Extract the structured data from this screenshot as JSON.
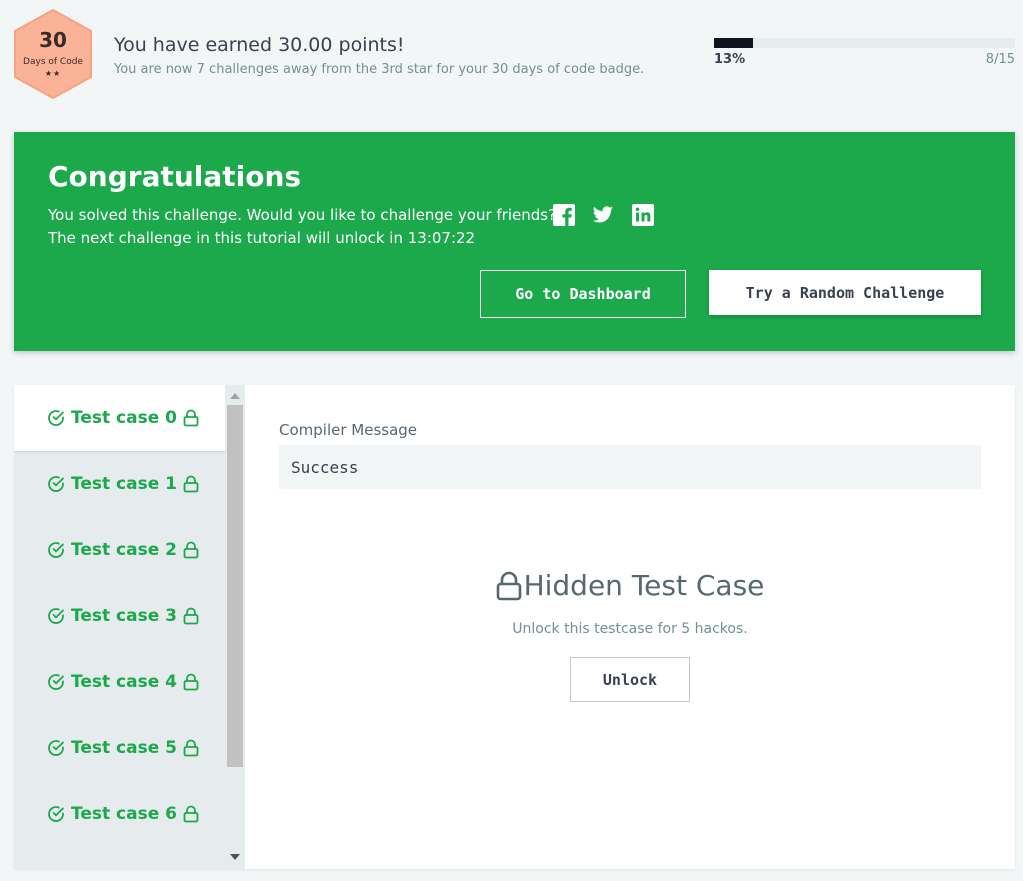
{
  "badge": {
    "number": "30",
    "caption": "Days of Code",
    "stars": "★★",
    "color": "#fbb397"
  },
  "earned": {
    "title": "You have earned 30.00 points!",
    "subtitle": "You are now 7 challenges away from the 3rd star for your 30 days of code badge."
  },
  "progress": {
    "percent_label": "13%",
    "fraction": 0.13,
    "count_label": "8/15"
  },
  "congrats": {
    "title": "Congratulations",
    "line1": "You solved this challenge. Would you like to challenge your friends?",
    "line2": "The next challenge in this tutorial will unlock in 13:07:22",
    "share_icons": [
      "facebook-icon",
      "twitter-icon",
      "linkedin-icon"
    ],
    "dashboard_button": "Go to Dashboard",
    "random_button": "Try a Random Challenge",
    "color": "#1ba94c"
  },
  "testcases": {
    "items": [
      {
        "label": "Test case 0",
        "active": true
      },
      {
        "label": "Test case 1",
        "active": false
      },
      {
        "label": "Test case 2",
        "active": false
      },
      {
        "label": "Test case 3",
        "active": false
      },
      {
        "label": "Test case 4",
        "active": false
      },
      {
        "label": "Test case 5",
        "active": false
      },
      {
        "label": "Test case 6",
        "active": false
      }
    ],
    "status_icon": "check-circle-icon",
    "lock_icon": "lock-icon"
  },
  "result": {
    "compiler_label": "Compiler Message",
    "compiler_message": "Success",
    "hidden_title": "Hidden Test Case",
    "hidden_sub": "Unlock this testcase for 5 hackos.",
    "unlock_button": "Unlock"
  }
}
